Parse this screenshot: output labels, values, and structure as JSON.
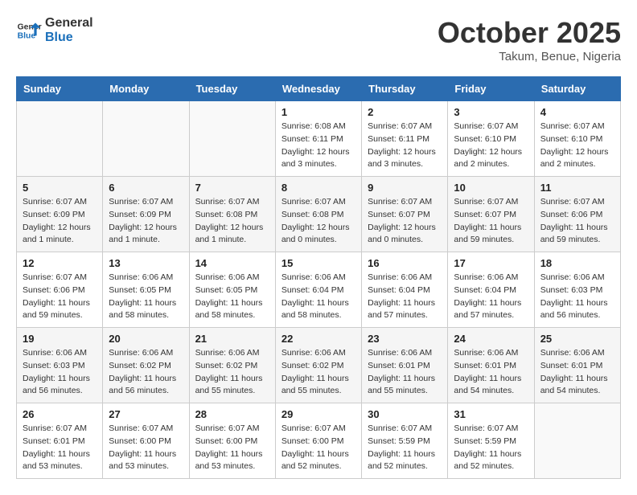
{
  "header": {
    "logo_line1": "General",
    "logo_line2": "Blue",
    "month": "October 2025",
    "location": "Takum, Benue, Nigeria"
  },
  "weekdays": [
    "Sunday",
    "Monday",
    "Tuesday",
    "Wednesday",
    "Thursday",
    "Friday",
    "Saturday"
  ],
  "weeks": [
    [
      {
        "day": "",
        "info": ""
      },
      {
        "day": "",
        "info": ""
      },
      {
        "day": "",
        "info": ""
      },
      {
        "day": "1",
        "info": "Sunrise: 6:08 AM\nSunset: 6:11 PM\nDaylight: 12 hours\nand 3 minutes."
      },
      {
        "day": "2",
        "info": "Sunrise: 6:07 AM\nSunset: 6:11 PM\nDaylight: 12 hours\nand 3 minutes."
      },
      {
        "day": "3",
        "info": "Sunrise: 6:07 AM\nSunset: 6:10 PM\nDaylight: 12 hours\nand 2 minutes."
      },
      {
        "day": "4",
        "info": "Sunrise: 6:07 AM\nSunset: 6:10 PM\nDaylight: 12 hours\nand 2 minutes."
      }
    ],
    [
      {
        "day": "5",
        "info": "Sunrise: 6:07 AM\nSunset: 6:09 PM\nDaylight: 12 hours\nand 1 minute."
      },
      {
        "day": "6",
        "info": "Sunrise: 6:07 AM\nSunset: 6:09 PM\nDaylight: 12 hours\nand 1 minute."
      },
      {
        "day": "7",
        "info": "Sunrise: 6:07 AM\nSunset: 6:08 PM\nDaylight: 12 hours\nand 1 minute."
      },
      {
        "day": "8",
        "info": "Sunrise: 6:07 AM\nSunset: 6:08 PM\nDaylight: 12 hours\nand 0 minutes."
      },
      {
        "day": "9",
        "info": "Sunrise: 6:07 AM\nSunset: 6:07 PM\nDaylight: 12 hours\nand 0 minutes."
      },
      {
        "day": "10",
        "info": "Sunrise: 6:07 AM\nSunset: 6:07 PM\nDaylight: 11 hours\nand 59 minutes."
      },
      {
        "day": "11",
        "info": "Sunrise: 6:07 AM\nSunset: 6:06 PM\nDaylight: 11 hours\nand 59 minutes."
      }
    ],
    [
      {
        "day": "12",
        "info": "Sunrise: 6:07 AM\nSunset: 6:06 PM\nDaylight: 11 hours\nand 59 minutes."
      },
      {
        "day": "13",
        "info": "Sunrise: 6:06 AM\nSunset: 6:05 PM\nDaylight: 11 hours\nand 58 minutes."
      },
      {
        "day": "14",
        "info": "Sunrise: 6:06 AM\nSunset: 6:05 PM\nDaylight: 11 hours\nand 58 minutes."
      },
      {
        "day": "15",
        "info": "Sunrise: 6:06 AM\nSunset: 6:04 PM\nDaylight: 11 hours\nand 58 minutes."
      },
      {
        "day": "16",
        "info": "Sunrise: 6:06 AM\nSunset: 6:04 PM\nDaylight: 11 hours\nand 57 minutes."
      },
      {
        "day": "17",
        "info": "Sunrise: 6:06 AM\nSunset: 6:04 PM\nDaylight: 11 hours\nand 57 minutes."
      },
      {
        "day": "18",
        "info": "Sunrise: 6:06 AM\nSunset: 6:03 PM\nDaylight: 11 hours\nand 56 minutes."
      }
    ],
    [
      {
        "day": "19",
        "info": "Sunrise: 6:06 AM\nSunset: 6:03 PM\nDaylight: 11 hours\nand 56 minutes."
      },
      {
        "day": "20",
        "info": "Sunrise: 6:06 AM\nSunset: 6:02 PM\nDaylight: 11 hours\nand 56 minutes."
      },
      {
        "day": "21",
        "info": "Sunrise: 6:06 AM\nSunset: 6:02 PM\nDaylight: 11 hours\nand 55 minutes."
      },
      {
        "day": "22",
        "info": "Sunrise: 6:06 AM\nSunset: 6:02 PM\nDaylight: 11 hours\nand 55 minutes."
      },
      {
        "day": "23",
        "info": "Sunrise: 6:06 AM\nSunset: 6:01 PM\nDaylight: 11 hours\nand 55 minutes."
      },
      {
        "day": "24",
        "info": "Sunrise: 6:06 AM\nSunset: 6:01 PM\nDaylight: 11 hours\nand 54 minutes."
      },
      {
        "day": "25",
        "info": "Sunrise: 6:06 AM\nSunset: 6:01 PM\nDaylight: 11 hours\nand 54 minutes."
      }
    ],
    [
      {
        "day": "26",
        "info": "Sunrise: 6:07 AM\nSunset: 6:01 PM\nDaylight: 11 hours\nand 53 minutes."
      },
      {
        "day": "27",
        "info": "Sunrise: 6:07 AM\nSunset: 6:00 PM\nDaylight: 11 hours\nand 53 minutes."
      },
      {
        "day": "28",
        "info": "Sunrise: 6:07 AM\nSunset: 6:00 PM\nDaylight: 11 hours\nand 53 minutes."
      },
      {
        "day": "29",
        "info": "Sunrise: 6:07 AM\nSunset: 6:00 PM\nDaylight: 11 hours\nand 52 minutes."
      },
      {
        "day": "30",
        "info": "Sunrise: 6:07 AM\nSunset: 5:59 PM\nDaylight: 11 hours\nand 52 minutes."
      },
      {
        "day": "31",
        "info": "Sunrise: 6:07 AM\nSunset: 5:59 PM\nDaylight: 11 hours\nand 52 minutes."
      },
      {
        "day": "",
        "info": ""
      }
    ]
  ]
}
